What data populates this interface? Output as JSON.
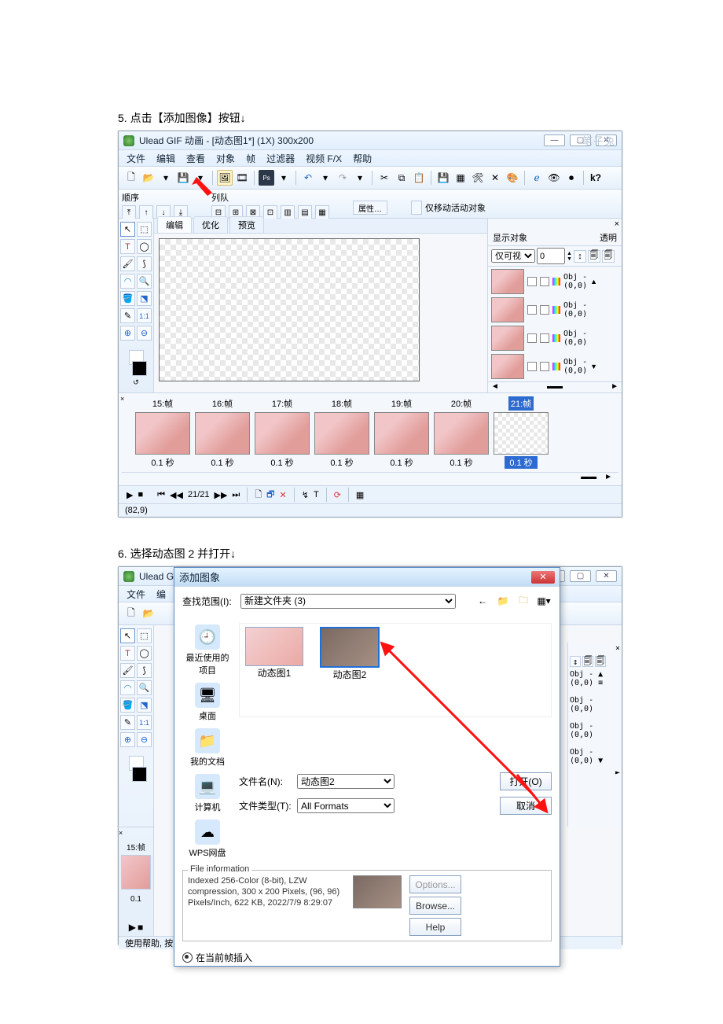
{
  "step5": {
    "num": "5.",
    "text": "点击【添加图像】按钮↓"
  },
  "win": {
    "title": "Ulead GIF 动画 - [动态图1*] (1X) 300x200",
    "watermark": "笔子兔",
    "menus": [
      "文件",
      "编辑",
      "查看",
      "对象",
      "帧",
      "过滤器",
      "视频 F/X",
      "帮助"
    ],
    "sub": {
      "order": "顺序",
      "align": "列队",
      "props": "属性…",
      "only": "仅移动活动对象"
    },
    "tabs": [
      "编辑",
      "优化",
      "预览"
    ],
    "right": {
      "show": "显示对象",
      "trans": "透明",
      "visible": "仅可视的",
      "val": "0"
    },
    "objs": [
      {
        "name": "Obj -",
        "pos": "(0,0)"
      },
      {
        "name": "Obj -",
        "pos": "(0,0)"
      },
      {
        "name": "Obj -",
        "pos": "(0,0)"
      },
      {
        "name": "Obj -",
        "pos": "(0,0)"
      }
    ],
    "frames": [
      {
        "id": "15:帧",
        "d": "0.1 秒"
      },
      {
        "id": "16:帧",
        "d": "0.1 秒"
      },
      {
        "id": "17:帧",
        "d": "0.1 秒"
      },
      {
        "id": "18:帧",
        "d": "0.1 秒"
      },
      {
        "id": "19:帧",
        "d": "0.1 秒"
      },
      {
        "id": "20:帧",
        "d": "0.1 秒"
      },
      {
        "id": "21:帧",
        "d": "0.1 秒"
      }
    ],
    "play": {
      "pos": "21/21"
    },
    "status": "(82,9)"
  },
  "step6": {
    "num": "6.",
    "text": "选择动态图 2 并打开↓"
  },
  "win2": {
    "title": "Ulead G",
    "menus": [
      "文件",
      "编"
    ],
    "status": "使用帮助, 按"
  },
  "dlg": {
    "title": "添加图象",
    "lookin_lbl": "查找范围(I):",
    "lookin": "新建文件夹 (3)",
    "side": [
      {
        "ico": "🕘",
        "lbl": "最近使用的项目"
      },
      {
        "ico": "🖥",
        "lbl": "桌面"
      },
      {
        "ico": "📁",
        "lbl": "我的文档"
      },
      {
        "ico": "💻",
        "lbl": "计算机"
      },
      {
        "ico": "☁",
        "lbl": "WPS网盘"
      }
    ],
    "thumbs": [
      {
        "name": "动态图1"
      },
      {
        "name": "动态图2"
      }
    ],
    "fname_lbl": "文件名(N):",
    "fname": "动态图2",
    "ftype_lbl": "文件类型(T):",
    "ftype": "All Formats",
    "open": "打开(O)",
    "cancel": "取消",
    "fileinfo": {
      "legend": "File information",
      "text": "Indexed 256-Color (8-bit), LZW compression, 300 x 200 Pixels, (96, 96) Pixels/Inch, 622 KB, 2022/7/9 8:29:07",
      "opt": "Options...",
      "browse": "Browse...",
      "help": "Help"
    },
    "insert": "在当前帧插入"
  }
}
